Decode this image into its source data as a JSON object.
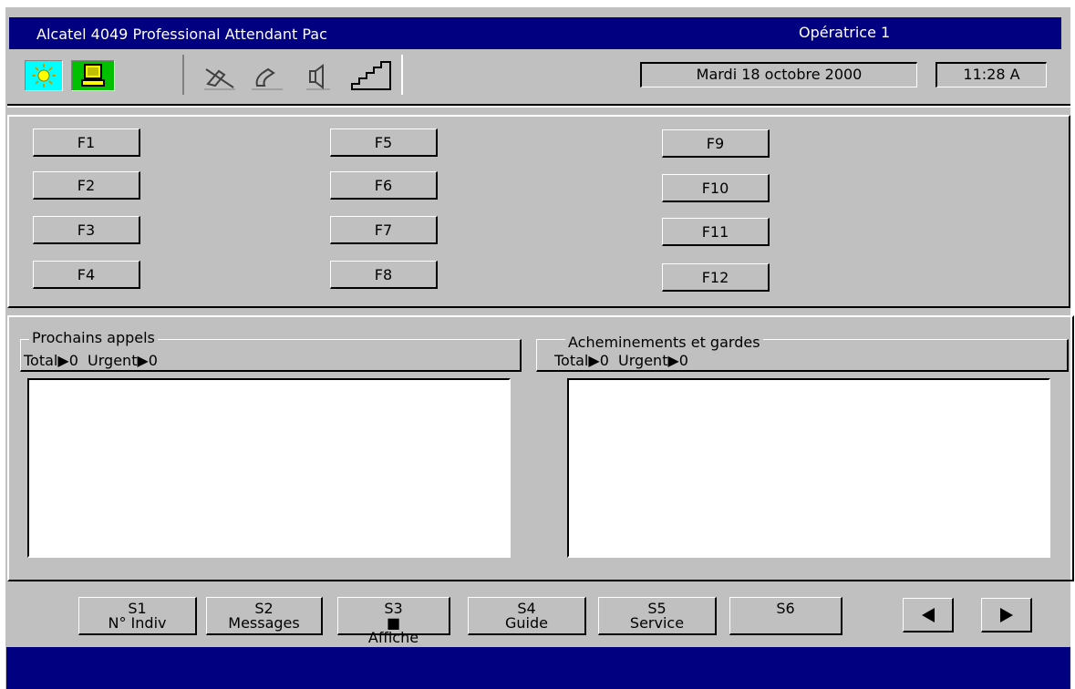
{
  "window": {
    "title": "Alcatel 4049 Professional Attendant Pac",
    "operator": "Opératrice 1"
  },
  "toolbar": {
    "icons": [
      "sun-icon",
      "computer-icon",
      "mute-mic-icon",
      "handset-icon",
      "speaker-icon",
      "volume-stairs-icon"
    ],
    "date": "Mardi 18 octobre 2000",
    "time": "11:28 A"
  },
  "function_keys": {
    "col1": [
      "F1",
      "F2",
      "F3",
      "F4"
    ],
    "col2": [
      "F5",
      "F6",
      "F7",
      "F8"
    ],
    "col3": [
      "F9",
      "F10",
      "F11",
      "F12"
    ]
  },
  "panels": {
    "next_calls": {
      "title": "Prochains appels",
      "total_label": "Total",
      "total_value": "0",
      "urgent_label": "Urgent",
      "urgent_value": "0"
    },
    "routing": {
      "title": "Acheminements et gardes",
      "total_label": "Total",
      "total_value": "0",
      "urgent_label": "Urgent",
      "urgent_value": "0"
    }
  },
  "softkeys": [
    {
      "key": "S1",
      "label": "N° Indiv"
    },
    {
      "key": "S2",
      "label": "Messages"
    },
    {
      "key": "S3",
      "label": "Affiche"
    },
    {
      "key": "S4",
      "label": "Guide"
    },
    {
      "key": "S5",
      "label": "Service"
    },
    {
      "key": "S6",
      "label": ""
    }
  ],
  "colors": {
    "titlebar": "#000080",
    "face": "#c0c0c0"
  }
}
